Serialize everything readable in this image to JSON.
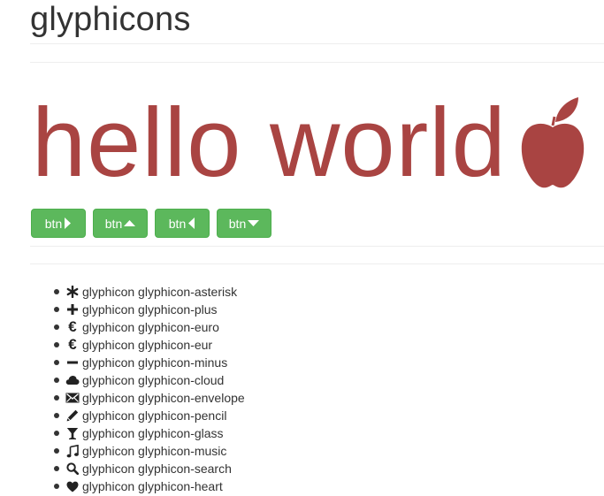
{
  "page": {
    "title": "glyphicons"
  },
  "hero": {
    "text": "hello world",
    "icon": "apple-icon",
    "color": "#a94442"
  },
  "buttons": [
    {
      "label": "btn",
      "icon": "triangle-right-icon"
    },
    {
      "label": "btn",
      "icon": "triangle-top-icon"
    },
    {
      "label": "btn",
      "icon": "triangle-left-icon"
    },
    {
      "label": "btn",
      "icon": "triangle-bottom-icon"
    }
  ],
  "button_color": "#5cb85c",
  "icon_list": [
    {
      "label": "glyphicon glyphicon-asterisk",
      "icon": "asterisk-icon"
    },
    {
      "label": "glyphicon glyphicon-plus",
      "icon": "plus-icon"
    },
    {
      "label": "glyphicon glyphicon-euro",
      "icon": "euro-icon"
    },
    {
      "label": "glyphicon glyphicon-eur",
      "icon": "eur-icon"
    },
    {
      "label": "glyphicon glyphicon-minus",
      "icon": "minus-icon"
    },
    {
      "label": "glyphicon glyphicon-cloud",
      "icon": "cloud-icon"
    },
    {
      "label": "glyphicon glyphicon-envelope",
      "icon": "envelope-icon"
    },
    {
      "label": "glyphicon glyphicon-pencil",
      "icon": "pencil-icon"
    },
    {
      "label": "glyphicon glyphicon-glass",
      "icon": "glass-icon"
    },
    {
      "label": "glyphicon glyphicon-music",
      "icon": "music-icon"
    },
    {
      "label": "glyphicon glyphicon-search",
      "icon": "search-icon"
    },
    {
      "label": "glyphicon glyphicon-heart",
      "icon": "heart-icon"
    }
  ]
}
